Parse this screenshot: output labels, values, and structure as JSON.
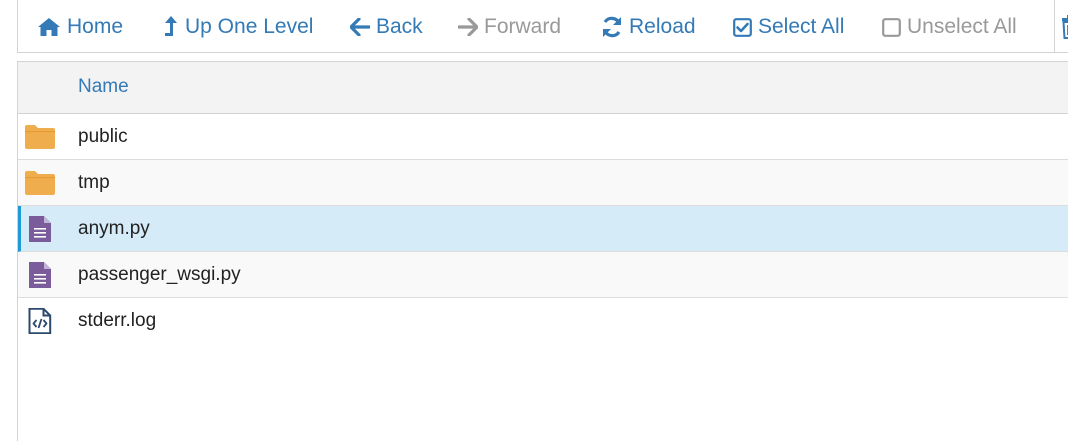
{
  "toolbar": {
    "home": "Home",
    "up": "Up One Level",
    "back": "Back",
    "forward": "Forward",
    "reload": "Reload",
    "select_all": "Select All",
    "unselect_all": "Unselect All"
  },
  "listing": {
    "column_name": "Name",
    "rows": [
      {
        "name": "public",
        "type": "folder"
      },
      {
        "name": "tmp",
        "type": "folder"
      },
      {
        "name": "anym.py",
        "type": "text-file",
        "selected": true
      },
      {
        "name": "passenger_wsgi.py",
        "type": "text-file"
      },
      {
        "name": "stderr.log",
        "type": "code-file"
      }
    ]
  },
  "colors": {
    "link": "#337ab7",
    "disabled": "#999999",
    "folder": "#f0ad4e",
    "file": "#7a5c9b",
    "selected_bg": "#d6ebf8",
    "selected_border": "#1e9bd7"
  }
}
